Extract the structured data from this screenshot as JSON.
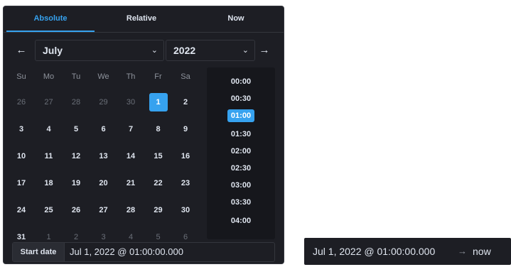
{
  "tabs": [
    {
      "label": "Absolute"
    },
    {
      "label": "Relative"
    },
    {
      "label": "Now"
    }
  ],
  "month": "July",
  "year": "2022",
  "weekdays": [
    "Su",
    "Mo",
    "Tu",
    "We",
    "Th",
    "Fr",
    "Sa"
  ],
  "weeks": [
    [
      "26",
      "27",
      "28",
      "29",
      "30",
      "1",
      "2"
    ],
    [
      "3",
      "4",
      "5",
      "6",
      "7",
      "8",
      "9"
    ],
    [
      "10",
      "11",
      "12",
      "13",
      "14",
      "15",
      "16"
    ],
    [
      "17",
      "18",
      "19",
      "20",
      "21",
      "22",
      "23"
    ],
    [
      "24",
      "25",
      "26",
      "27",
      "28",
      "29",
      "30"
    ],
    [
      "31",
      "1",
      "2",
      "3",
      "4",
      "5",
      "6"
    ]
  ],
  "selected_day": "1",
  "times": [
    "00:00",
    "00:30",
    "01:00",
    "01:30",
    "02:00",
    "02:30",
    "03:00",
    "03:30",
    "04:00"
  ],
  "selected_time": "01:00",
  "start": {
    "label": "Start date",
    "value": "Jul 1, 2022 @ 01:00:00.000"
  },
  "range": {
    "start": "Jul 1, 2022 @ 01:00:00.000",
    "end": "now"
  },
  "colors": {
    "accent": "#36a2ef",
    "panel": "#1d1e24"
  },
  "icons": {
    "prev": "arrow-left-icon",
    "next": "arrow-right-icon",
    "chevron": "chevron-down-icon"
  }
}
